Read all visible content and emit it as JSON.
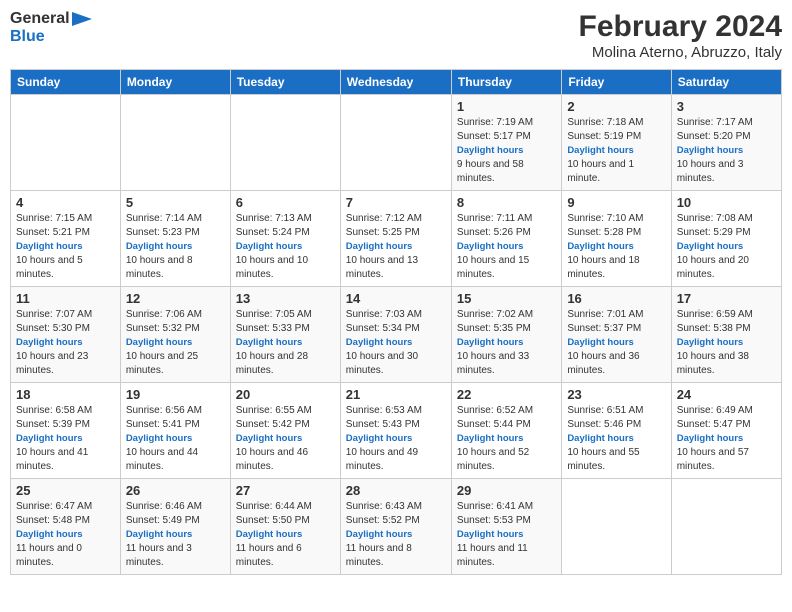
{
  "logo": {
    "line1": "General",
    "line2": "Blue"
  },
  "title": "February 2024",
  "location": "Molina Aterno, Abruzzo, Italy",
  "days_of_week": [
    "Sunday",
    "Monday",
    "Tuesday",
    "Wednesday",
    "Thursday",
    "Friday",
    "Saturday"
  ],
  "weeks": [
    [
      {
        "day": "",
        "sunrise": "",
        "sunset": "",
        "daylight": ""
      },
      {
        "day": "",
        "sunrise": "",
        "sunset": "",
        "daylight": ""
      },
      {
        "day": "",
        "sunrise": "",
        "sunset": "",
        "daylight": ""
      },
      {
        "day": "",
        "sunrise": "",
        "sunset": "",
        "daylight": ""
      },
      {
        "day": "1",
        "sunrise": "7:19 AM",
        "sunset": "5:17 PM",
        "daylight": "9 hours and 58 minutes."
      },
      {
        "day": "2",
        "sunrise": "7:18 AM",
        "sunset": "5:19 PM",
        "daylight": "10 hours and 1 minute."
      },
      {
        "day": "3",
        "sunrise": "7:17 AM",
        "sunset": "5:20 PM",
        "daylight": "10 hours and 3 minutes."
      }
    ],
    [
      {
        "day": "4",
        "sunrise": "7:15 AM",
        "sunset": "5:21 PM",
        "daylight": "10 hours and 5 minutes."
      },
      {
        "day": "5",
        "sunrise": "7:14 AM",
        "sunset": "5:23 PM",
        "daylight": "10 hours and 8 minutes."
      },
      {
        "day": "6",
        "sunrise": "7:13 AM",
        "sunset": "5:24 PM",
        "daylight": "10 hours and 10 minutes."
      },
      {
        "day": "7",
        "sunrise": "7:12 AM",
        "sunset": "5:25 PM",
        "daylight": "10 hours and 13 minutes."
      },
      {
        "day": "8",
        "sunrise": "7:11 AM",
        "sunset": "5:26 PM",
        "daylight": "10 hours and 15 minutes."
      },
      {
        "day": "9",
        "sunrise": "7:10 AM",
        "sunset": "5:28 PM",
        "daylight": "10 hours and 18 minutes."
      },
      {
        "day": "10",
        "sunrise": "7:08 AM",
        "sunset": "5:29 PM",
        "daylight": "10 hours and 20 minutes."
      }
    ],
    [
      {
        "day": "11",
        "sunrise": "7:07 AM",
        "sunset": "5:30 PM",
        "daylight": "10 hours and 23 minutes."
      },
      {
        "day": "12",
        "sunrise": "7:06 AM",
        "sunset": "5:32 PM",
        "daylight": "10 hours and 25 minutes."
      },
      {
        "day": "13",
        "sunrise": "7:05 AM",
        "sunset": "5:33 PM",
        "daylight": "10 hours and 28 minutes."
      },
      {
        "day": "14",
        "sunrise": "7:03 AM",
        "sunset": "5:34 PM",
        "daylight": "10 hours and 30 minutes."
      },
      {
        "day": "15",
        "sunrise": "7:02 AM",
        "sunset": "5:35 PM",
        "daylight": "10 hours and 33 minutes."
      },
      {
        "day": "16",
        "sunrise": "7:01 AM",
        "sunset": "5:37 PM",
        "daylight": "10 hours and 36 minutes."
      },
      {
        "day": "17",
        "sunrise": "6:59 AM",
        "sunset": "5:38 PM",
        "daylight": "10 hours and 38 minutes."
      }
    ],
    [
      {
        "day": "18",
        "sunrise": "6:58 AM",
        "sunset": "5:39 PM",
        "daylight": "10 hours and 41 minutes."
      },
      {
        "day": "19",
        "sunrise": "6:56 AM",
        "sunset": "5:41 PM",
        "daylight": "10 hours and 44 minutes."
      },
      {
        "day": "20",
        "sunrise": "6:55 AM",
        "sunset": "5:42 PM",
        "daylight": "10 hours and 46 minutes."
      },
      {
        "day": "21",
        "sunrise": "6:53 AM",
        "sunset": "5:43 PM",
        "daylight": "10 hours and 49 minutes."
      },
      {
        "day": "22",
        "sunrise": "6:52 AM",
        "sunset": "5:44 PM",
        "daylight": "10 hours and 52 minutes."
      },
      {
        "day": "23",
        "sunrise": "6:51 AM",
        "sunset": "5:46 PM",
        "daylight": "10 hours and 55 minutes."
      },
      {
        "day": "24",
        "sunrise": "6:49 AM",
        "sunset": "5:47 PM",
        "daylight": "10 hours and 57 minutes."
      }
    ],
    [
      {
        "day": "25",
        "sunrise": "6:47 AM",
        "sunset": "5:48 PM",
        "daylight": "11 hours and 0 minutes."
      },
      {
        "day": "26",
        "sunrise": "6:46 AM",
        "sunset": "5:49 PM",
        "daylight": "11 hours and 3 minutes."
      },
      {
        "day": "27",
        "sunrise": "6:44 AM",
        "sunset": "5:50 PM",
        "daylight": "11 hours and 6 minutes."
      },
      {
        "day": "28",
        "sunrise": "6:43 AM",
        "sunset": "5:52 PM",
        "daylight": "11 hours and 8 minutes."
      },
      {
        "day": "29",
        "sunrise": "6:41 AM",
        "sunset": "5:53 PM",
        "daylight": "11 hours and 11 minutes."
      },
      {
        "day": "",
        "sunrise": "",
        "sunset": "",
        "daylight": ""
      },
      {
        "day": "",
        "sunrise": "",
        "sunset": "",
        "daylight": ""
      }
    ]
  ],
  "labels": {
    "sunrise": "Sunrise:",
    "sunset": "Sunset:",
    "daylight": "Daylight hours"
  }
}
